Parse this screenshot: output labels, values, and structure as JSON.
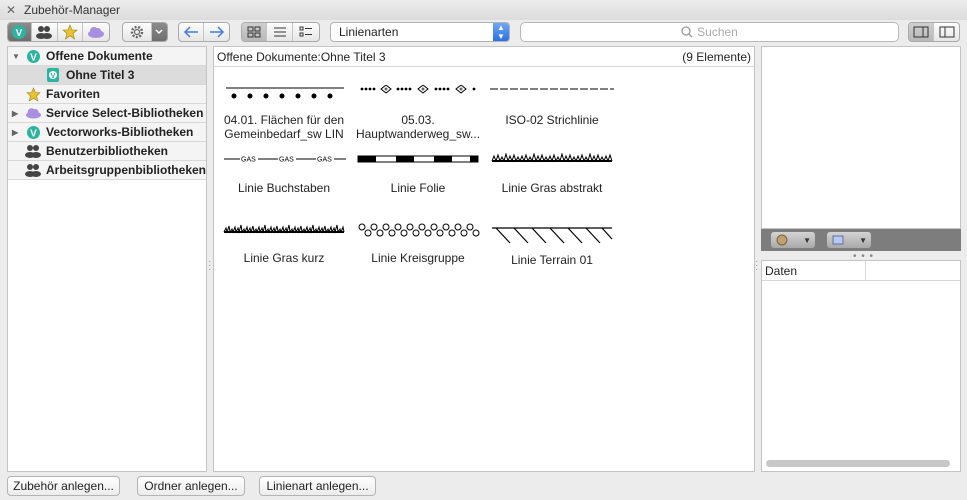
{
  "window": {
    "title": "Zubehör-Manager"
  },
  "toolbar": {
    "linestyle_select": "Linienarten",
    "search_placeholder": "Suchen"
  },
  "sidebar": {
    "items": [
      {
        "label": "Offene Dokumente",
        "expanded": true,
        "icon": "vectorworks-icon"
      },
      {
        "label": "Ohne Titel 3",
        "child": true,
        "selected": true,
        "icon": "document-icon"
      },
      {
        "label": "Favoriten",
        "icon": "star-icon"
      },
      {
        "label": "Service Select-Bibliotheken",
        "expanded": false,
        "icon": "cloud-icon"
      },
      {
        "label": "Vectorworks-Bibliotheken",
        "expanded": false,
        "icon": "vectorworks-icon"
      },
      {
        "label": "Benutzerbibliotheken",
        "icon": "users-icon"
      },
      {
        "label": "Arbeitsgruppenbibliotheken",
        "icon": "users-icon"
      }
    ]
  },
  "main": {
    "path": "Offene Dokumente:Ohne Titel 3",
    "count": "(9 Elemente)",
    "items": [
      {
        "line1": "04.01. Flächen für den",
        "line2": "Gemeinbedarf_sw LIN"
      },
      {
        "line1": "05.03.",
        "line2": "Hauptwanderweg_sw..."
      },
      {
        "line1": "ISO-02 Strichlinie"
      },
      {
        "line1": "Linie Buchstaben",
        "glyph": "GAS"
      },
      {
        "line1": "Linie Folie"
      },
      {
        "line1": "Linie Gras abstrakt"
      },
      {
        "line1": "Linie Gras kurz"
      },
      {
        "line1": "Linie Kreisgruppe"
      },
      {
        "line1": "Linie Terrain 01"
      }
    ]
  },
  "data_panel": {
    "header": "Daten"
  },
  "buttons": {
    "new_resource": "Zubehör anlegen...",
    "new_folder": "Ordner anlegen...",
    "new_linetype": "Linienart anlegen..."
  },
  "colors": {
    "vectorworks_green": "#2bb5a0",
    "star_yellow": "#e8c230",
    "cloud_purple": "#a88fe0",
    "nav_arrow_blue": "#3d7be8"
  }
}
